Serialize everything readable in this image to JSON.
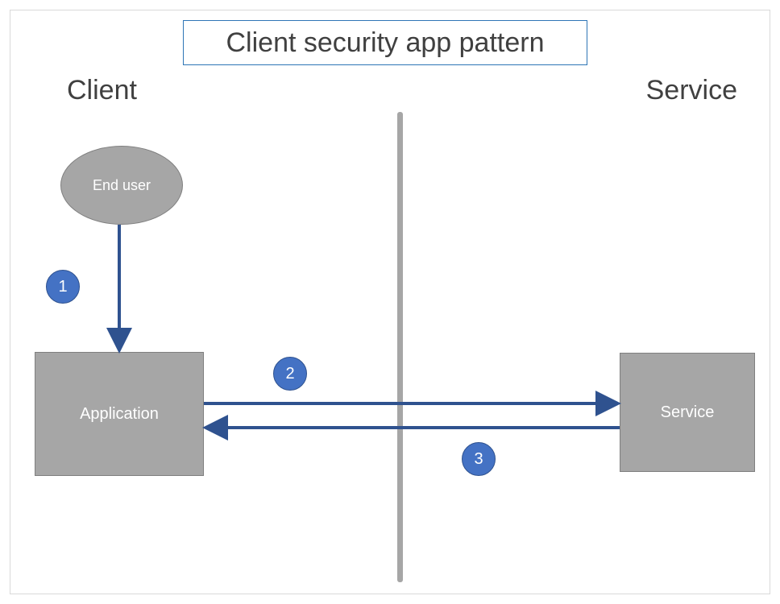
{
  "title": "Client security app pattern",
  "sections": {
    "left": "Client",
    "right": "Service"
  },
  "nodes": {
    "end_user": "End user",
    "application": "Application",
    "service": "Service"
  },
  "steps": {
    "one": {
      "num": "1",
      "from": "end_user",
      "to": "application",
      "direction": "down"
    },
    "two": {
      "num": "2",
      "from": "application",
      "to": "service",
      "direction": "right"
    },
    "three": {
      "num": "3",
      "from": "service",
      "to": "application",
      "direction": "left"
    }
  },
  "colors": {
    "badge_fill": "#4472c4",
    "badge_stroke": "#2f528f",
    "arrow": "#2f528f",
    "node_fill": "#a6a6a6",
    "title_border": "#2e75b6"
  }
}
